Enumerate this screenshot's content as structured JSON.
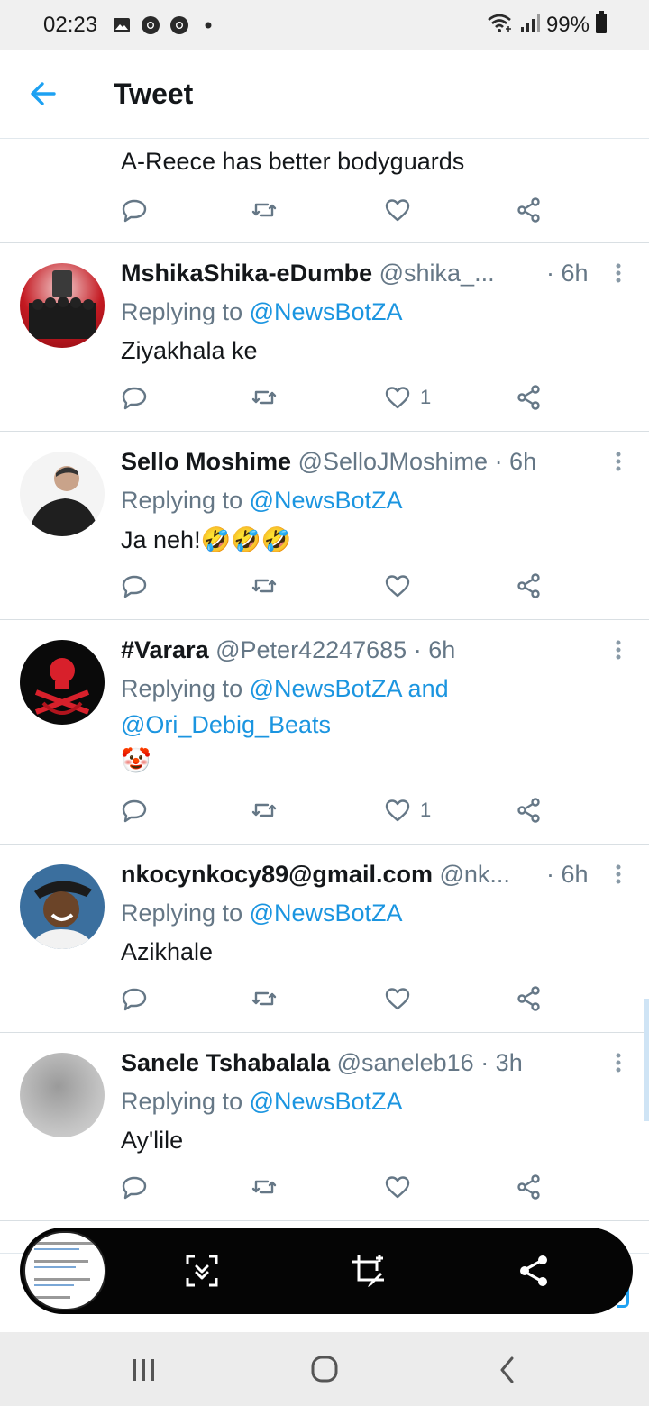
{
  "status_bar": {
    "time": "02:23",
    "battery": "99%",
    "icons": [
      "gallery-icon",
      "chrome-icon",
      "chrome-icon",
      "dot-icon",
      "wifi-icon",
      "signal-icon",
      "battery-icon"
    ]
  },
  "header": {
    "title": "Tweet"
  },
  "tweets": [
    {
      "text": "A-Reece has better bodyguards"
    },
    {
      "name": "MshikaShika-eDumbe",
      "handle": "@shika_...",
      "time": "· 6h",
      "replying_prefix": "Replying to ",
      "replying_to": "@NewsBotZA",
      "text": "Ziyakhala ke",
      "likes": "1"
    },
    {
      "name": "Sello Moshime",
      "handle": "@SelloJMoshime",
      "time": "· 6h",
      "replying_prefix": "Replying to ",
      "replying_to": "@NewsBotZA",
      "text": "Ja neh!🤣🤣🤣",
      "likes": ""
    },
    {
      "name": "#Varara",
      "handle": "@Peter42247685",
      "time": "· 6h",
      "replying_prefix": "Replying to ",
      "replying_to": "@NewsBotZA and",
      "replying_to_2": "@Ori_Debig_Beats",
      "text": "🤡",
      "likes": "1"
    },
    {
      "name": "nkocynkocy89@gmail.com",
      "handle": "@nk...",
      "time": "· 6h",
      "replying_prefix": "Replying to ",
      "replying_to": "@NewsBotZA",
      "text": "Azikhale",
      "likes": ""
    },
    {
      "name": "Sanele Tshabalala",
      "handle": "@saneleb16",
      "time": "· 3h",
      "replying_prefix": "Replying to ",
      "replying_to": "@NewsBotZA",
      "text": "Ay'lile",
      "likes": ""
    }
  ],
  "colors": {
    "link": "#1b95e0",
    "secondary_text": "#657786",
    "accent": "#1da1f2",
    "toolbar": "#050505"
  },
  "screenshot_toolbar": {
    "icons": [
      "screenshot-thumbnail",
      "scroll-capture-icon",
      "crop-edit-icon",
      "share-icon"
    ]
  },
  "nav_bar": {
    "icons": [
      "recent-apps-icon",
      "home-icon",
      "back-icon"
    ]
  }
}
